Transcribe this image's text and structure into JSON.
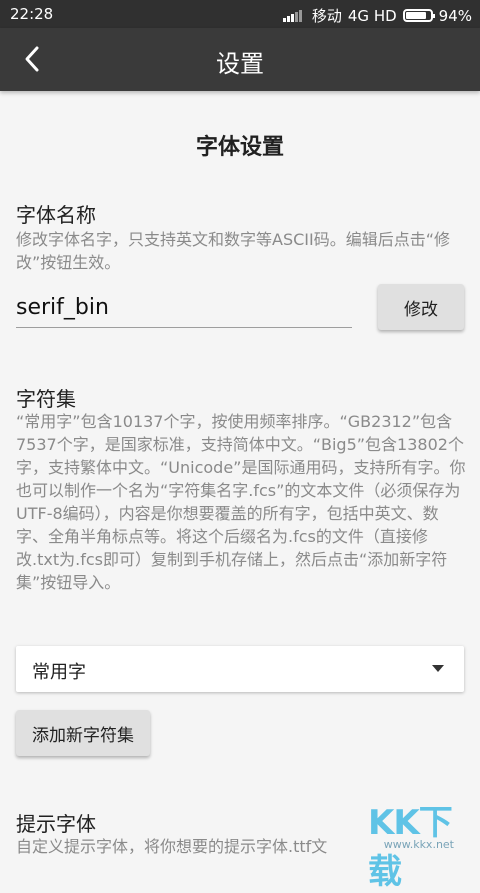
{
  "status_bar": {
    "time": "22:28",
    "carrier": "移动",
    "network": "4G HD",
    "battery": "94%",
    "battery_level": 0.94
  },
  "app_bar": {
    "back_icon": "chevron-left-icon",
    "title": "设置"
  },
  "main": {
    "section_title": "字体设置",
    "font_name": {
      "label": "字体名称",
      "description": "修改字体名字，只支持英文和数字等ASCII码。编辑后点击“修改”按钮生效。",
      "value": "serif_bin",
      "modify_label": "修改"
    },
    "charset": {
      "label": "字符集",
      "description": "“常用字”包含10137个字，按使用频率排序。“GB2312”包含7537个字，是国家标准，支持简体中文。“Big5”包含13802个字，支持繁体中文。“Unicode”是国际通用码，支持所有字。你也可以制作一个名为“字符集名字.fcs”的文本文件（必须保存为UTF-8编码），内容是你想要覆盖的所有字，包括中英文、数字、全角半角标点等。将这个后缀名为.fcs的文件（直接修改.txt为.fcs即可）复制到手机存储上，然后点击“添加新字符集”按钮导入。",
      "selected": "常用字",
      "add_label": "添加新字符集"
    },
    "hint_font": {
      "label": "提示字体",
      "description": "自定义提示字体，将你想要的提示字体.ttf文"
    }
  },
  "watermark": {
    "text": "KK下载",
    "url": "www.kkx.net"
  }
}
